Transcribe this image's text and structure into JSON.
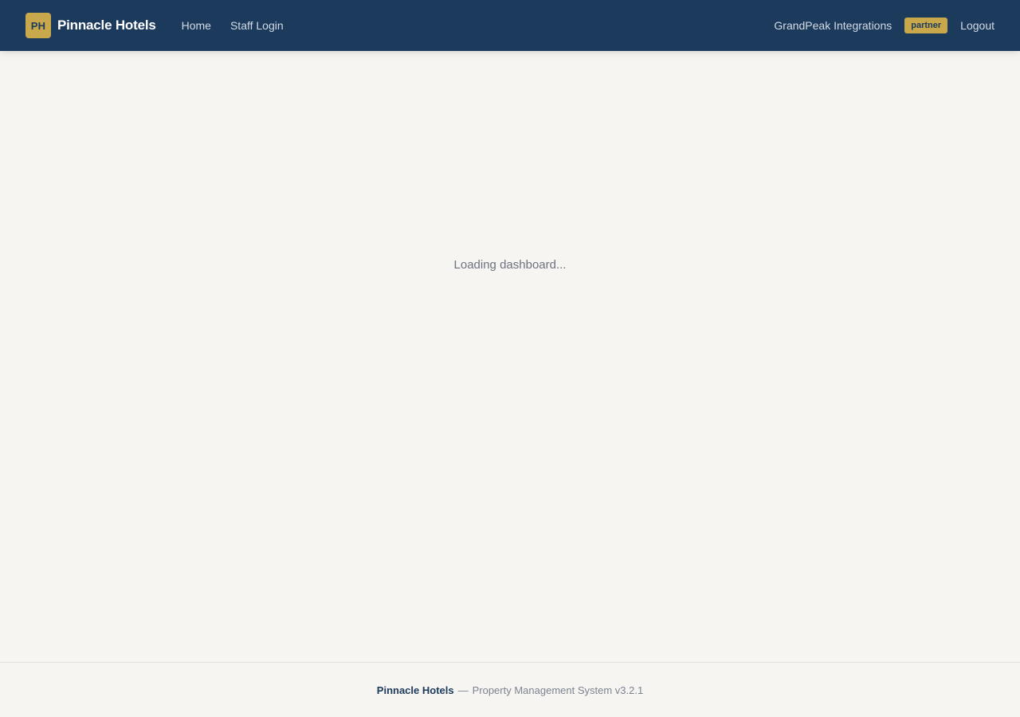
{
  "header": {
    "logo_initials": "PH",
    "brand_name": "Pinnacle Hotels",
    "nav": [
      {
        "label": "Home"
      },
      {
        "label": "Staff Login"
      }
    ],
    "organization": "GrandPeak Integrations",
    "role_badge": "partner",
    "logout_label": "Logout"
  },
  "main": {
    "loading_message": "Loading dashboard..."
  },
  "footer": {
    "brand": "Pinnacle Hotels",
    "separator": "—",
    "system_text": "Property Management System v3.2.1"
  },
  "colors": {
    "header_bg": "#1b3a5c",
    "accent_gold": "#c9a84c",
    "page_bg": "#f7f5f1"
  }
}
